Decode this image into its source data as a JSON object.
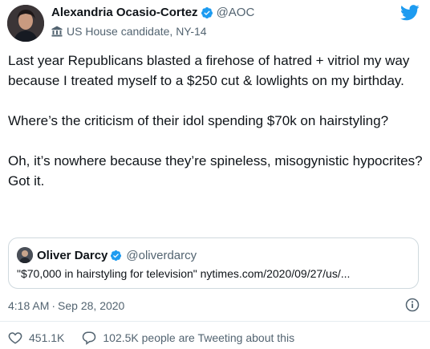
{
  "author": {
    "display_name": "Alexandria Ocasio-Cortez",
    "handle": "@AOC",
    "label": "US House candidate, NY-14"
  },
  "tweet": {
    "paragraphs": [
      "Last year Republicans blasted a firehose of hatred + vitriol my way because I treated myself to a $250 cut & lowlights on my birthday.",
      "Where’s the criticism of their idol spending $70k on hairstyling?",
      "Oh, it’s nowhere because they’re spineless, misogynistic hypocrites? Got it."
    ]
  },
  "quoted": {
    "display_name": "Oliver Darcy",
    "handle": "@oliverdarcy",
    "text": "\"$70,000 in hairstyling for television\" nytimes.com/2020/09/27/us/..."
  },
  "meta": {
    "time": "4:18 AM",
    "separator": "·",
    "date": "Sep 28, 2020"
  },
  "actions": {
    "likes": "451.1K",
    "tweeting": "102.5K people are Tweeting about this"
  },
  "colors": {
    "twitter_blue": "#1d9bf0",
    "secondary_text": "#536471",
    "border": "#cfd9de"
  },
  "icons": [
    "verified-badge-icon",
    "government-building-icon",
    "twitter-bird-icon",
    "info-icon",
    "heart-icon",
    "chat-bubble-icon"
  ]
}
